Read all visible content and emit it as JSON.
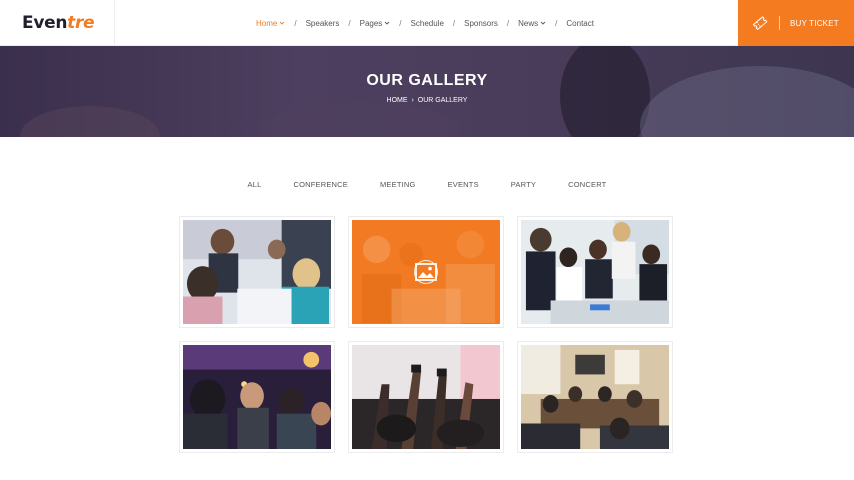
{
  "header": {
    "logo_main": "Even",
    "logo_accent": "tre",
    "nav": [
      {
        "label": "Home",
        "dropdown": true,
        "active": true
      },
      {
        "label": "Speakers",
        "dropdown": false,
        "active": false
      },
      {
        "label": "Pages",
        "dropdown": true,
        "active": false
      },
      {
        "label": "Schedule",
        "dropdown": false,
        "active": false
      },
      {
        "label": "Sponsors",
        "dropdown": false,
        "active": false
      },
      {
        "label": "News",
        "dropdown": true,
        "active": false
      },
      {
        "label": "Contact",
        "dropdown": false,
        "active": false
      }
    ],
    "separator": "/",
    "buy_label": "BUY TICKET"
  },
  "banner": {
    "title": "OUR GALLERY",
    "crumb_home": "HOME",
    "crumb_sep": "›",
    "crumb_current": "OUR GALLERY"
  },
  "filters": [
    "ALL",
    "CONFERENCE",
    "MEETING",
    "EVENTS",
    "PARTY",
    "CONCERT"
  ],
  "gallery": [
    {
      "icon": "conference-photo",
      "hovered": false
    },
    {
      "icon": "image-icon",
      "hovered": true
    },
    {
      "icon": "meeting-photo",
      "hovered": false
    },
    {
      "icon": "party-photo",
      "hovered": false
    },
    {
      "icon": "concert-photo",
      "hovered": false
    },
    {
      "icon": "seminar-photo",
      "hovered": false
    }
  ],
  "colors": {
    "accent": "#f47b20",
    "banner": "#4a3d5b",
    "text": "#555555"
  }
}
